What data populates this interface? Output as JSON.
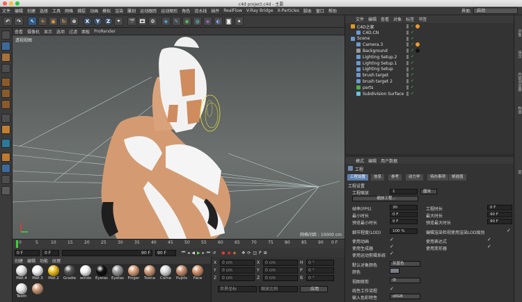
{
  "window": {
    "title": "c4d project.c4d - 主要"
  },
  "menubar": {
    "items": [
      "文件",
      "编辑",
      "创建",
      "选择",
      "工具",
      "网格",
      "捕捉",
      "动画",
      "模拟",
      "渲染",
      "雕刻",
      "运动跟踪",
      "运动图形",
      "角色",
      "流水线",
      "插件",
      "RealFlow",
      "V-Ray Bridge",
      "X-Particles",
      "脚本",
      "窗口",
      "帮助"
    ],
    "layout_label": "界面:",
    "layout_value": "启动"
  },
  "viewport": {
    "menu": [
      "查看",
      "摄像机",
      "显示",
      "选项",
      "过滤",
      "面板",
      "ProRender"
    ],
    "label": "透视视图",
    "grid": "网格间距 : 10000 cm"
  },
  "timeline": {
    "ticks": [
      "0",
      "5",
      "10",
      "15",
      "20",
      "25",
      "30",
      "35",
      "40",
      "45",
      "50",
      "55",
      "60",
      "65",
      "70",
      "75",
      "80",
      "85",
      "90"
    ],
    "start": "0 F",
    "current": "0 F",
    "end": "90 F",
    "end2": "90 F"
  },
  "materials": {
    "menu": [
      "创建",
      "编辑",
      "功能",
      "纹理"
    ],
    "items": [
      {
        "name": "Mat.4",
        "color": "#e6e6e6"
      },
      {
        "name": "Mat.3",
        "color": "#f2f2f2"
      },
      {
        "name": "Mat.2",
        "color": "#f0c020"
      },
      {
        "name": "Gradie",
        "color": "#555555"
      },
      {
        "name": "windo",
        "color": "#f4f4f4"
      },
      {
        "name": "Eyelas",
        "color": "#111111"
      },
      {
        "name": "Eyelas",
        "color": "#9a9a9a"
      },
      {
        "name": "Finger",
        "color": "#d9a07a"
      },
      {
        "name": "Toena",
        "color": "#cf9a78"
      },
      {
        "name": "Corne",
        "color": "#dddddd"
      },
      {
        "name": "Pupils",
        "color": "#c89070"
      },
      {
        "name": "Face",
        "color": "#d4956e"
      },
      {
        "name": "Teeth",
        "color": "#e8e8e8"
      },
      {
        "name": "",
        "color": "#cc9a7a"
      }
    ]
  },
  "coords": {
    "x1": "0 cm",
    "y1": "0 cm",
    "z1": "0 cm",
    "x2": "0 cm",
    "y2": "0 cm",
    "z2": "0 cm",
    "h": "0 °",
    "p": "0 °",
    "b": "0 °",
    "mode": "世界坐标",
    "scale": "缩放比例",
    "apply": "应用",
    "labels": [
      "X",
      "Y",
      "Z",
      "X",
      "Y",
      "Z",
      "H",
      "P",
      "B"
    ]
  },
  "objmanager": {
    "menu": [
      "文件",
      "编辑",
      "查看",
      "对象",
      "标签",
      "书签"
    ],
    "objects": [
      {
        "name": "C4D之家",
        "level": 0
      },
      {
        "name": "C4D.CN",
        "level": 1
      },
      {
        "name": "Scene",
        "level": 0
      },
      {
        "name": "Camera.3",
        "level": 1
      },
      {
        "name": "Background",
        "level": 1
      },
      {
        "name": "Lighting Setup.2",
        "level": 1
      },
      {
        "name": "Lighting Setup.1",
        "level": 1
      },
      {
        "name": "Lighting Setup",
        "level": 1
      },
      {
        "name": "brush target",
        "level": 1
      },
      {
        "name": "brush target 2",
        "level": 1
      },
      {
        "name": "parts",
        "level": 1
      },
      {
        "name": "Subdivision Surface",
        "level": 1
      }
    ]
  },
  "right_tabs": [
    "对象",
    "场次",
    "内容浏览器",
    "构造",
    "层"
  ],
  "attr": {
    "menu": [
      "模式",
      "编辑",
      "用户数据"
    ],
    "header": "工程",
    "tabs": [
      "工程设置",
      "信息",
      "参考",
      "动力学",
      "待办事项",
      "帧插值"
    ],
    "section": "工程设置",
    "scale_label": "工程缩放",
    "scale_val": "1",
    "scale_unit": "厘米",
    "scale_btn": "缩放工程...",
    "fps_label": "帧率(FPS)",
    "fps_val": "30",
    "min_label": "最小时长",
    "min_val": "0 F",
    "premin_label": "预览最小时长",
    "premin_val": "0 F",
    "len_label": "工程时长",
    "len_val": "0 F",
    "max_label": "最大时长",
    "max_val": "90 F",
    "premax_label": "预览最大时长",
    "premax_val": "90 F",
    "lod_label": "细节程度(LOD)",
    "lod_val": "100 %",
    "lod2": "编辑渲染检视使用渲染LOD级别",
    "anim": "使用动画",
    "expr": "使用表达式",
    "gen": "使用生成器",
    "deform": "使用变形器",
    "motion": "使用运动剪辑系统",
    "objcolor_label": "默认对象颜色",
    "objcolor_val": "灰蓝色",
    "color_label": "颜色",
    "clip_label": "视图修剪",
    "clip_val": "中",
    "linear": "线性工作流程",
    "input_label": "输入色彩特性",
    "input_val": "sRGB"
  }
}
